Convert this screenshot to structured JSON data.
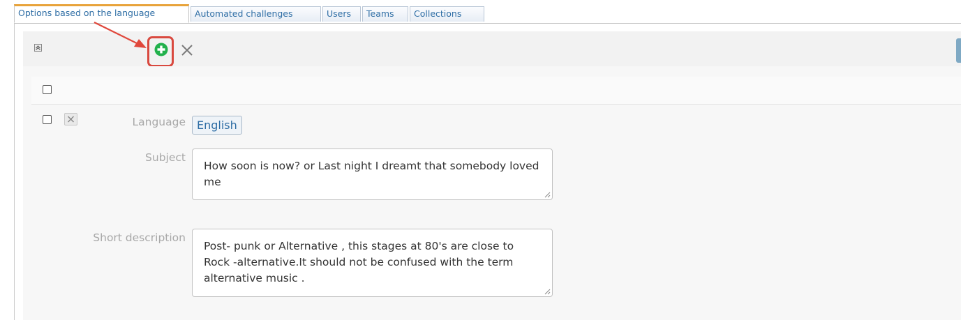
{
  "tabs": [
    {
      "label": "Options based on the language",
      "active": true
    },
    {
      "label": "Automated challenges",
      "active": false
    },
    {
      "label": "Users",
      "active": false
    },
    {
      "label": "Teams",
      "active": false
    },
    {
      "label": "Collections",
      "active": false
    }
  ],
  "toolbar": {
    "collapse_icon": "collapse-up-icon",
    "add_icon": "add-circle-icon",
    "delete_icon": "close-x-icon",
    "add_icon_color": "#22b14c",
    "highlight_color": "#d9493f"
  },
  "form": {
    "language_label": "Language",
    "language_value": "English",
    "subject_label": "Subject",
    "subject_value": "How soon is now? or Last night I dreamt that somebody loved me",
    "short_description_label": "Short description",
    "short_description_value": "Post- punk or Alternative , this stages at 80's are close to Rock -alternative.It should not be confused with the term alternative music ."
  }
}
